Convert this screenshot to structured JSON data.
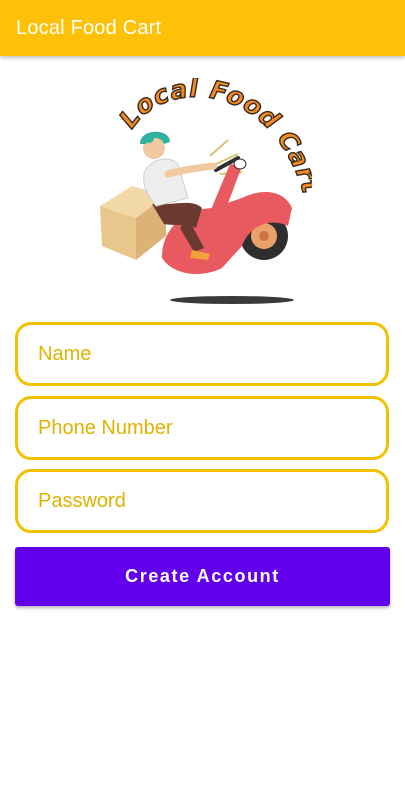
{
  "app": {
    "title": "Local Food Cart"
  },
  "logo": {
    "text": "Local Food Cart",
    "icon": "scooter-delivery-logo"
  },
  "form": {
    "name_placeholder": "Name",
    "name_value": "",
    "phone_placeholder": "Phone Number",
    "phone_value": "",
    "password_placeholder": "Password",
    "password_value": "",
    "submit_label": "Create Account"
  },
  "colors": {
    "appbar": "#FFC107",
    "field_border": "#F2C200",
    "placeholder": "#E2B200",
    "button": "#6200EE",
    "scooter": "#E85A5F",
    "logo_text": "#F08A24"
  }
}
